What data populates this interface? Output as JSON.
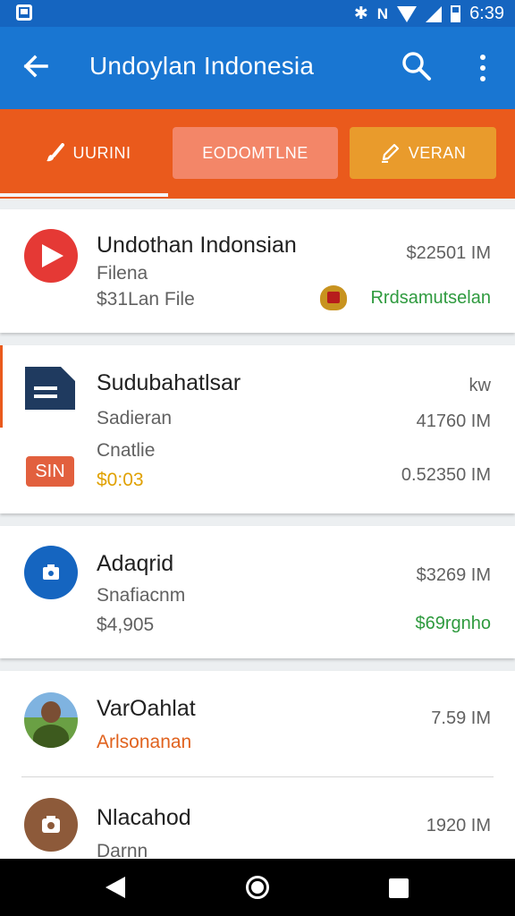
{
  "status_bar": {
    "time": "6:39"
  },
  "app_bar": {
    "title": "Undoylan Indonesia"
  },
  "tabs": [
    {
      "label": "UURINI",
      "icon": "brush-icon",
      "selected": true
    },
    {
      "label": "EODOMTLNE"
    },
    {
      "label": "VERAN",
      "icon": "edit-icon"
    }
  ],
  "items": [
    {
      "title": "Undothan Indonsian",
      "subtitle": "Filena",
      "detail": "$31Lan File",
      "amount": "$22501 IM",
      "tag": "Rrdsamutselan",
      "icon": "play-icon"
    },
    {
      "title": "Sudubahatlsar",
      "subtitle": "Sadieran",
      "detail": "Cnatlie",
      "badge": "SIN",
      "price": "$0:03",
      "amount_top": "kw",
      "amount_mid": "41760 IM",
      "amount_bottom": "0.52350 IM",
      "icon": "document-icon"
    },
    {
      "title": "Adaqrid",
      "subtitle": "Snafiacnm",
      "detail": "$4,905",
      "amount": "$3269 IM",
      "tag": "$69rgnho",
      "icon": "camera-icon"
    },
    {
      "title": "VarOahlat",
      "subtitle": "Arlsonanan",
      "amount": "7.59 IM",
      "icon": "avatar-photo"
    },
    {
      "title": "Nlacahod",
      "subtitle": "Darnn",
      "amount": "1920 IM",
      "icon": "camera-icon"
    }
  ],
  "colors": {
    "app_bar": "#1976d2",
    "tab_strip": "#ea5a1c",
    "positive": "#2e9a3e",
    "accent_orange": "#e0621e",
    "price_gold": "#e0a100"
  }
}
